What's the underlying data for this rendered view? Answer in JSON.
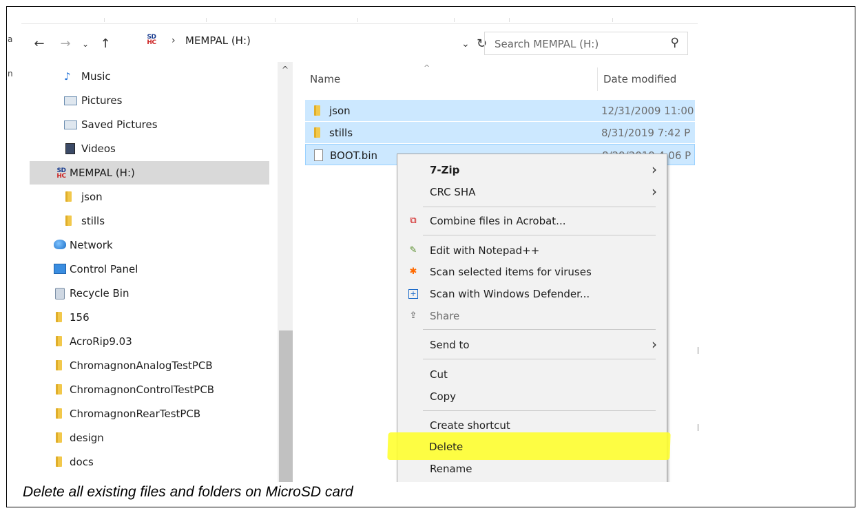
{
  "window": {
    "back_icon": "back-arrow-icon",
    "forward_icon": "forward-arrow-icon",
    "recent_icon": "chevron-down-icon",
    "up_icon": "up-arrow-icon",
    "sd_icon_top": "SD",
    "sd_icon_bottom": "HC",
    "breadcrumb": "MEMPAL (H:)",
    "search_placeholder": "Search MEMPAL (H:)"
  },
  "nav_pane": {
    "items": [
      {
        "label": "Music",
        "icon": "music-icon"
      },
      {
        "label": "Pictures",
        "icon": "pictures-icon"
      },
      {
        "label": "Saved Pictures",
        "icon": "pictures-icon"
      },
      {
        "label": "Videos",
        "icon": "videos-icon"
      },
      {
        "label": "MEMPAL (H:)",
        "icon": "sd-card-icon",
        "selected": true
      },
      {
        "label": "json",
        "icon": "folder-icon"
      },
      {
        "label": "stills",
        "icon": "folder-icon"
      },
      {
        "label": "Network",
        "icon": "network-icon"
      },
      {
        "label": "Control Panel",
        "icon": "control-panel-icon"
      },
      {
        "label": "Recycle Bin",
        "icon": "recycle-bin-icon"
      },
      {
        "label": "156",
        "icon": "folder-icon"
      },
      {
        "label": "AcroRip9.03",
        "icon": "folder-icon"
      },
      {
        "label": "ChromagnonAnalogTestPCB",
        "icon": "folder-icon"
      },
      {
        "label": "ChromagnonControlTestPCB",
        "icon": "folder-icon"
      },
      {
        "label": "ChromagnonRearTestPCB",
        "icon": "folder-icon"
      },
      {
        "label": "design",
        "icon": "folder-icon"
      },
      {
        "label": "docs",
        "icon": "folder-icon"
      }
    ]
  },
  "file_list": {
    "columns": [
      "Name",
      "Date modified"
    ],
    "rows": [
      {
        "name": "json",
        "date": "12/31/2009 11:00",
        "icon": "folder-icon"
      },
      {
        "name": "stills",
        "date": "8/31/2019 7:42 P",
        "icon": "folder-icon"
      },
      {
        "name": "BOOT.bin",
        "date": "8/29/2019 4:06 P",
        "icon": "file-icon"
      }
    ]
  },
  "context_menu": {
    "items": [
      {
        "label": "7-Zip",
        "submenu": true
      },
      {
        "label": "CRC SHA",
        "submenu": true
      },
      {
        "label": "Combine files in Acrobat...",
        "icon": "acrobat-icon"
      },
      {
        "label": "Edit with Notepad++",
        "icon": "notepad-icon"
      },
      {
        "label": "Scan selected items for viruses",
        "icon": "avast-icon"
      },
      {
        "label": "Scan with Windows Defender...",
        "icon": "defender-icon"
      },
      {
        "label": "Share",
        "icon": "share-icon"
      },
      {
        "label": "Send to",
        "submenu": true
      },
      {
        "label": "Cut"
      },
      {
        "label": "Copy"
      },
      {
        "label": "Create shortcut"
      },
      {
        "label": "Delete",
        "highlighted": true,
        "highlight_color": "#ffff24"
      },
      {
        "label": "Rename"
      }
    ]
  },
  "caption": "Delete all existing files and folders on MicroSD card"
}
